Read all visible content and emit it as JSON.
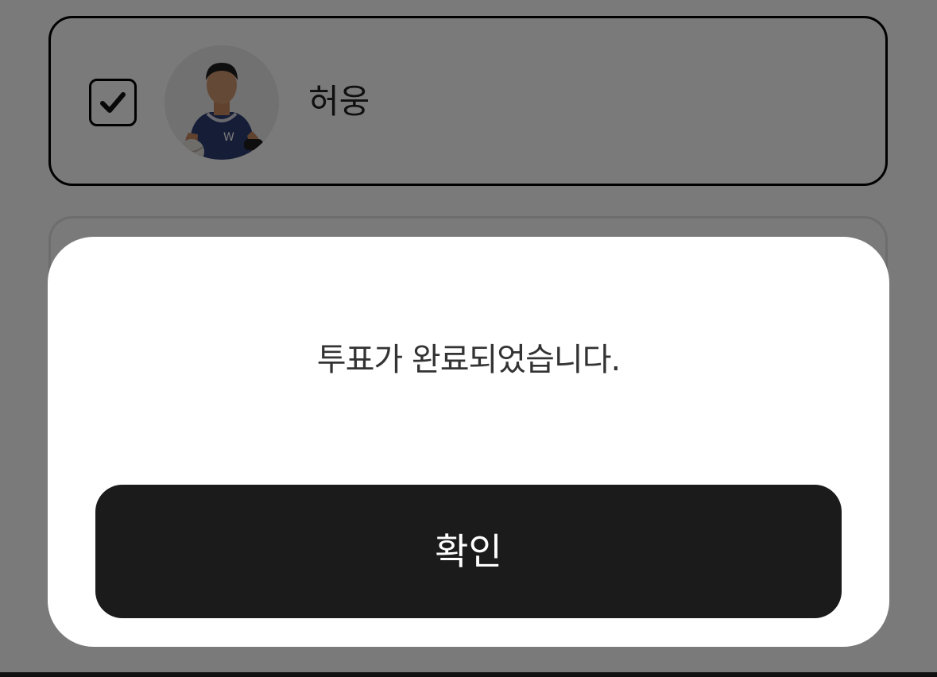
{
  "candidates": [
    {
      "name": "허웅",
      "selected": true,
      "avatar_icon": "player-photo-avatar"
    },
    {
      "name": "",
      "selected": false
    }
  ],
  "modal": {
    "message": "투표가 완료되었습니다.",
    "confirm_label": "확인"
  },
  "colors": {
    "button_background": "#1b1b1b",
    "selected_border": "#000000",
    "overlay": "rgba(0,0,0,0.52)"
  }
}
